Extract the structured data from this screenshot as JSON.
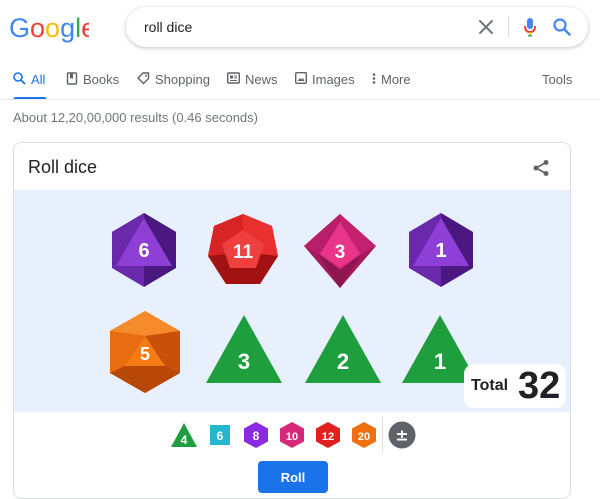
{
  "logo": {
    "text": "Google"
  },
  "search": {
    "value": "roll dice"
  },
  "tabs": [
    {
      "label": "All",
      "icon": "search-icon",
      "active": true
    },
    {
      "label": "Books",
      "icon": "book-icon"
    },
    {
      "label": "Shopping",
      "icon": "tag-icon"
    },
    {
      "label": "News",
      "icon": "news-icon"
    },
    {
      "label": "Images",
      "icon": "image-icon"
    },
    {
      "label": "More",
      "icon": "more-vert-icon"
    }
  ],
  "tools_label": "Tools",
  "result_stats": "About 12,20,00,000 results (0.46 seconds)",
  "card": {
    "title": "Roll dice",
    "dice": [
      {
        "type": "d8",
        "value": "6",
        "color": "#7b2fbf"
      },
      {
        "type": "d12",
        "value": "11",
        "color": "#e02020"
      },
      {
        "type": "d10",
        "value": "3",
        "color": "#d6287a"
      },
      {
        "type": "d8",
        "value": "1",
        "color": "#7b2fbf"
      },
      {
        "type": "d20",
        "value": "5",
        "color": "#f07010"
      },
      {
        "type": "d4",
        "value": "3",
        "color": "#1e9e3c"
      },
      {
        "type": "d4",
        "value": "2",
        "color": "#1e9e3c"
      },
      {
        "type": "d4",
        "value": "1",
        "color": "#1e9e3c"
      }
    ],
    "total_label": "Total",
    "total_value": "32",
    "die_choices": [
      {
        "label": "4",
        "color": "#1e9e3c",
        "shape": "triangle"
      },
      {
        "label": "6",
        "color": "#26b6cf",
        "shape": "square"
      },
      {
        "label": "8",
        "color": "#8a2be2",
        "shape": "hexagon"
      },
      {
        "label": "10",
        "color": "#d6287a",
        "shape": "hexagon"
      },
      {
        "label": "12",
        "color": "#e02020",
        "shape": "hexagon"
      },
      {
        "label": "20",
        "color": "#f07010",
        "shape": "hexagon"
      },
      {
        "label": "±",
        "color": "#5f6368",
        "shape": "circle"
      }
    ],
    "roll_label": "Roll"
  }
}
